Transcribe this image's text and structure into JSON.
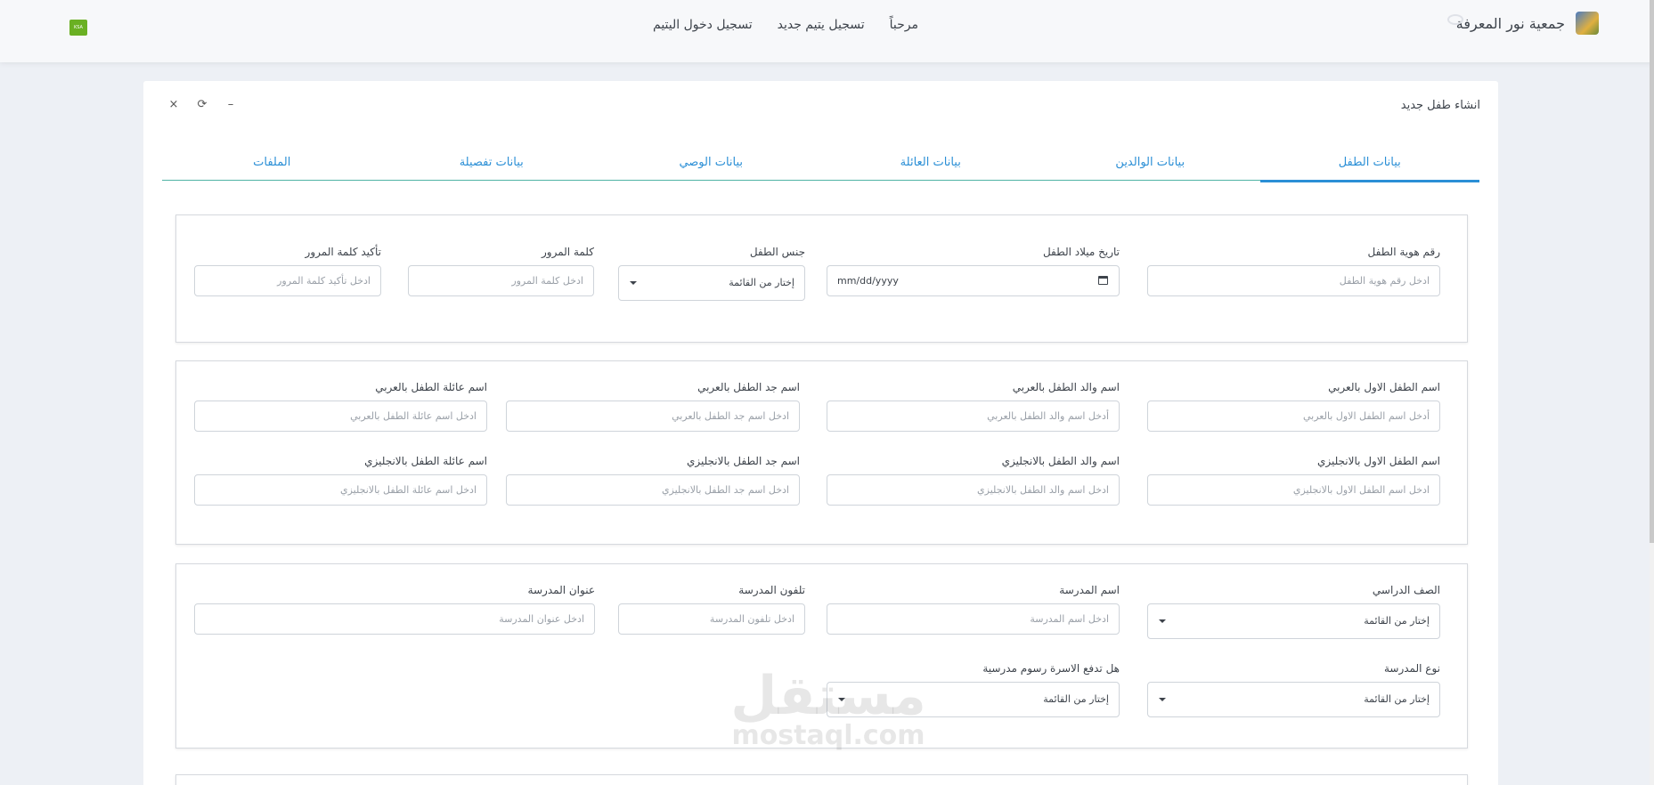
{
  "brand": {
    "name": "جمعية نور المعرفة"
  },
  "nav": {
    "welcome": "مرحباً",
    "register_orphan": "تسجيل يتيم جديد",
    "orphan_login": "تسجيل دخول اليتيم"
  },
  "badge": {
    "text": "KSA"
  },
  "card": {
    "title": "انشاء طفل جديد",
    "minimize": "–",
    "refresh": "⟳",
    "close": "×"
  },
  "tabs": [
    "بيانات الطفل",
    "بيانات الوالدين",
    "بيانات العائلة",
    "بيانات الوصي",
    "بيانات تفصيلة",
    "الملفات"
  ],
  "s1": {
    "id_label": "رقم هوية الطفل",
    "id_ph": "ادخل رقم هوية الطفل",
    "dob_label": "تاريخ ميلاد الطفل",
    "dob_ph": "mm/dd/yyyy",
    "gender_label": "جنس الطفل",
    "gender_val": "إختار من القائمة",
    "pass_label": "كلمة المرور",
    "pass_ph": "ادخل كلمة المرور",
    "confirm_label": "تأكيد كلمة المرور",
    "confirm_ph": "ادخل تأكيد كلمة المرور"
  },
  "s2": {
    "first_ar_label": "اسم الطفل الاول بالعربي",
    "first_ar_ph": "أدخل اسم الطفل الاول بالعربي",
    "father_ar_label": "اسم والد الطفل بالعربي",
    "father_ar_ph": "أدخل اسم والد الطفل  بالعربي",
    "grand_ar_label": "اسم جد الطفل بالعربي",
    "grand_ar_ph": "ادخل اسم جد الطفل بالعربي",
    "family_ar_label": "اسم عائلة الطفل بالعربي",
    "family_ar_ph": "ادخل اسم عائلة الطفل  بالعربي",
    "first_en_label": "اسم الطفل الاول بالانجليزي",
    "first_en_ph": "ادخل اسم الطفل الاول بالانجليزي",
    "father_en_label": "اسم والد الطفل بالانجليزي",
    "father_en_ph": "ادخل اسم والد الطفل  بالانجليزي",
    "grand_en_label": "اسم جد الطفل بالانجليزي",
    "grand_en_ph": "ادخل اسم جد الطفل بالانجليزي",
    "family_en_label": "اسم عائلة الطفل بالانجليزي",
    "family_en_ph": "ادخل اسم عائلة الطفل  بالانجليزي"
  },
  "s3": {
    "grade_label": "الصف الدراسي",
    "grade_val": "إختار من القائمة",
    "school_label": "اسم المدرسة",
    "school_ph": "ادخل اسم المدرسة",
    "phone_label": "تلفون المدرسة",
    "phone_ph": "ادخل تلفون المدرسة",
    "address_label": "عنوان المدرسة",
    "address_ph": "ادخل عنوان المدرسة",
    "type_label": "نوع المدرسة",
    "type_val": "إختار من القائمة",
    "fees_label": "هل تدفع الاسرة رسوم مدرسية",
    "fees_val": "إختار من القائمة"
  },
  "watermark": {
    "ar": "مستقل",
    "en": "mostaql.com"
  }
}
